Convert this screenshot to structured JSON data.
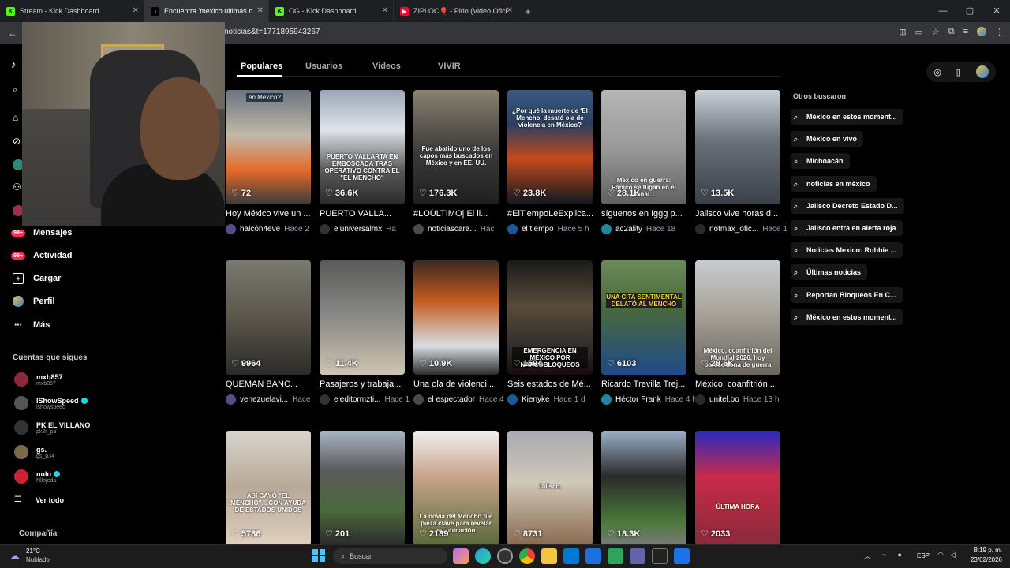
{
  "browser": {
    "tabs": [
      {
        "label": "Stream - Kick Dashboard",
        "icon": "kick-icon"
      },
      {
        "label": "Encuentra 'mexico ultimas noti",
        "icon": "tiktok-icon",
        "active": true
      },
      {
        "label": "OG - Kick Dashboard",
        "icon": "kick-icon"
      },
      {
        "label": "ZIPLOC🎈 - Pirlo (Video Oficial",
        "icon": "youtube-icon"
      }
    ],
    "url": "noticias&t=1771895943267",
    "new_tab": "+"
  },
  "search_tabs": [
    "Populares",
    "Usuarios",
    "Videos",
    "VIVIR"
  ],
  "sidebar": {
    "items": [
      {
        "label": "Mensajes",
        "badge": "99+"
      },
      {
        "label": "Actividad",
        "badge": "99+"
      },
      {
        "label": "Cargar"
      },
      {
        "label": "Perfil"
      },
      {
        "label": "Más"
      }
    ],
    "following_title": "Cuentas que sigues",
    "following": [
      {
        "name": "mxb857",
        "handle": "mxb857",
        "verified": false
      },
      {
        "name": "IShowSpeed",
        "handle": "ishowspeed",
        "verified": true
      },
      {
        "name": "PK EL VILLANO",
        "handle": "pk2r_pa",
        "verified": false
      },
      {
        "name": "gs.",
        "handle": "gs_p34",
        "verified": false
      },
      {
        "name": "nulo",
        "handle": "Nllojeda",
        "verified": true
      }
    ],
    "see_all": "Ver todo",
    "company": "Compañía"
  },
  "videos": [
    {
      "views": "72",
      "caption": "Hoy México vive un ...",
      "user": "halcón4eve",
      "ago": "Hace 2",
      "overlay": "en México?"
    },
    {
      "views": "36.6K",
      "caption": "PUERTO VALLA...",
      "user": "eluniversalmx",
      "ago": "Ha",
      "overlay": "PUERTO VALLARTA EN EMBOSCADA TRAS OPERATIVO CONTRA EL \"EL MENCHO\""
    },
    {
      "views": "176.3K",
      "caption": "#LOÚLTIMO| El ll...",
      "user": "noticiascara...",
      "ago": "Hac",
      "overlay": "Fue abatido uno de los capos más buscados en México y en EE. UU."
    },
    {
      "views": "23.8K",
      "caption": "#ElTiempoLeExplica...",
      "user": "el tiempo",
      "ago": "Hace 5 h",
      "overlay": "¿Por qué la muerte de 'El Mencho' desató ola de violencia en México?"
    },
    {
      "views": "28.1K",
      "caption": "síguenos en Iggg p...",
      "user": "ac2ality",
      "ago": "Hace 18",
      "overlay": "México en guerra: Pánico se fugan en el penal..."
    },
    {
      "views": "13.5K",
      "caption": "Jalisco vive horas d...",
      "user": "notmax_ofic...",
      "ago": "Hace 1",
      "overlay": ""
    },
    {
      "views": "9964",
      "caption": "QUEMAN BANC...",
      "user": "venezuelavi...",
      "ago": "Hace",
      "overlay": ""
    },
    {
      "views": "11.4K",
      "caption": "Pasajeros y trabaja...",
      "user": "eleditormzti...",
      "ago": "Hace 1",
      "overlay": ""
    },
    {
      "views": "10.9K",
      "caption": "Una ola de violenci...",
      "user": "el espectador",
      "ago": "Hace 4",
      "overlay": ""
    },
    {
      "views": "1594",
      "caption": "Seis estados de Mé...",
      "user": "Kienyke",
      "ago": "Hace 1 d",
      "overlay": "EMERGENCIA EN MÉXICO POR NARCOBLOQUEOS"
    },
    {
      "views": "6103",
      "caption": "Ricardo Trevilla Trej...",
      "user": "Héctor Frank",
      "ago": "Hace 4 h",
      "overlay": "UNA CITA SENTIMENTAL DELATÓ AL MENCHO"
    },
    {
      "views": "28.6K",
      "caption": "México, coanfitrión ...",
      "user": "unitel.bo",
      "ago": "Hace 13 h",
      "overlay": "México, coanfitrión del Mundial 2026, hoy parece zona de guerra"
    },
    {
      "views": "5786",
      "caption": "",
      "user": "",
      "ago": "",
      "overlay": "ASÍ CAYÓ \"EL MENCHO\"... CON AYUDA DE ESTADOS UNIDOS"
    },
    {
      "views": "201",
      "caption": "",
      "user": "",
      "ago": "",
      "overlay": ""
    },
    {
      "views": "2189",
      "caption": "",
      "user": "",
      "ago": "",
      "overlay": "La novia del Mencho fue pieza clave para revelar su ubicación"
    },
    {
      "views": "8731",
      "caption": "",
      "user": "",
      "ago": "",
      "overlay": "Jalisco."
    },
    {
      "views": "18.3K",
      "caption": "",
      "user": "",
      "ago": "",
      "overlay": ""
    },
    {
      "views": "2033",
      "caption": "",
      "user": "",
      "ago": "",
      "overlay": "ÚLTIMA HORA"
    }
  ],
  "others": {
    "title": "Otros buscaron",
    "items": [
      "México en estos moment...",
      "México en vivo",
      "Michoacán",
      "noticias en méxico",
      "Jalisco Decreto Estado D...",
      "Jalisco entra en alerta roja",
      "Noticias Mexico: Robbie ...",
      "Últimas noticias",
      "Reportan Bloqueos En C...",
      "México en estos moment..."
    ]
  },
  "taskbar": {
    "weather_temp": "21°C",
    "weather_desc": "Nublado",
    "search_placeholder": "Buscar",
    "lang": "ESP",
    "time": "8:19 p. m.",
    "date": "23/02/2026"
  },
  "colors": {
    "accent": "#fe2c55",
    "verified": "#20d5ec"
  }
}
